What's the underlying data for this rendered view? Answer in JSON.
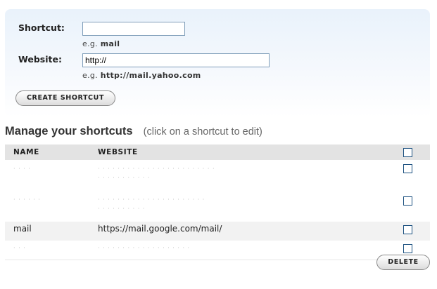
{
  "form": {
    "shortcut_label": "Shortcut:",
    "shortcut_value": "",
    "shortcut_hint_prefix": "e.g.",
    "shortcut_hint_example": "mail",
    "website_label": "Website:",
    "website_value": "http://",
    "website_hint_prefix": "e.g.",
    "website_hint_example": "http://mail.yahoo.com",
    "create_button": "CREATE SHORTCUT"
  },
  "manage": {
    "title": "Manage your shortcuts",
    "subtitle": "(click on a shortcut to edit)"
  },
  "table": {
    "columns": [
      "NAME",
      "WEBSITE"
    ],
    "rows": [
      {
        "name": "· · · ·",
        "website_line1": "· · · ·  · · · · · ·  · · · · · ·  · · · · · · · ·",
        "website_line2": "· · · · · · · · · · ·"
      },
      {
        "name": "· · · · · ·",
        "website_line1": "· · · · · · · ·  · · · · · · · · · · · · · ·",
        "website_line2": "· · · · · · · · · ·"
      },
      {
        "name": "mail",
        "website_line1": "https://mail.google.com/mail/",
        "website_line2": ""
      },
      {
        "name": "· · ·",
        "website_line1": "· · · · · · · · · · · · · · · · · · ·",
        "website_line2": ""
      }
    ]
  },
  "delete_button": "DELETE"
}
